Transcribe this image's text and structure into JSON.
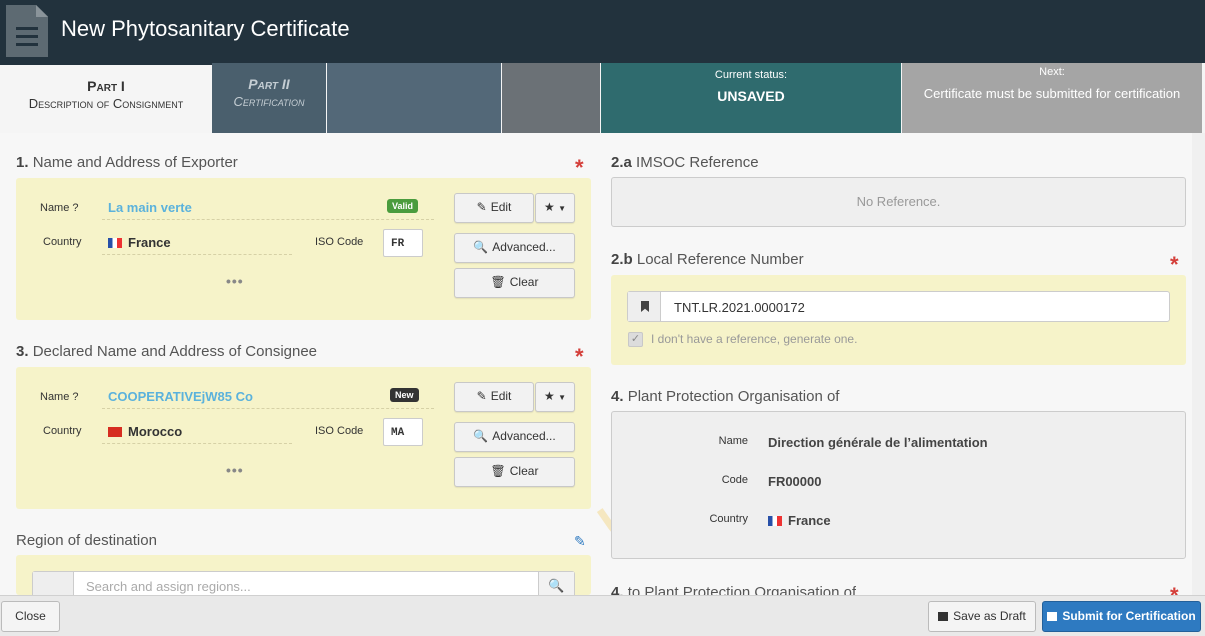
{
  "header": {
    "title": "New Phytosanitary Certificate",
    "icon": "document-icon"
  },
  "tabs": {
    "part1": {
      "title": "Part I",
      "subtitle": "Description of Consignment"
    },
    "part2": {
      "title": "Part II",
      "subtitle": "Certification"
    },
    "status": {
      "label": "Current status:",
      "value": "UNSAVED"
    },
    "next": {
      "label": "Next:",
      "value": "Certificate must be submitted for certification"
    }
  },
  "exporter": {
    "number": "1.",
    "title": "Name and Address of Exporter",
    "name_label": "Name",
    "name_value": "La main verte",
    "badge": "Valid",
    "country_label": "Country",
    "country_value": "France",
    "iso_label": "ISO Code",
    "iso_value": "FR",
    "edit": "Edit",
    "advanced": "Advanced...",
    "clear": "Clear",
    "more": "•••"
  },
  "consignee": {
    "number": "3.",
    "title": "Declared Name and Address of Consignee",
    "name_label": "Name",
    "name_value": "COOPERATIVEjW85 Co",
    "badge": "New",
    "country_label": "Country",
    "country_value": "Morocco",
    "iso_label": "ISO Code",
    "iso_value": "MA",
    "edit": "Edit",
    "advanced": "Advanced...",
    "clear": "Clear",
    "more": "•••"
  },
  "region": {
    "title": "Region of destination",
    "placeholder": "Search and assign regions..."
  },
  "imsoc": {
    "number": "2.a",
    "title": "IMSOC Reference",
    "value": "No Reference."
  },
  "lrn": {
    "number": "2.b",
    "title": "Local Reference Number",
    "value": "TNT.LR.2021.0000172",
    "checkbox_label": "I don't have a reference, generate one."
  },
  "ppo": {
    "number": "4.",
    "title": "Plant Protection Organisation of",
    "name_label": "Name",
    "name_value": "Direction générale de l’alimentation",
    "code_label": "Code",
    "code_value": "FR00000",
    "country_label": "Country",
    "country_value": "France"
  },
  "ppo_to": {
    "number": "4.",
    "title": "to Plant Protection Organisation of"
  },
  "watermark": "UNO",
  "footer": {
    "close": "Close",
    "draft": "Save as Draft",
    "submit": "Submit for Certification"
  }
}
